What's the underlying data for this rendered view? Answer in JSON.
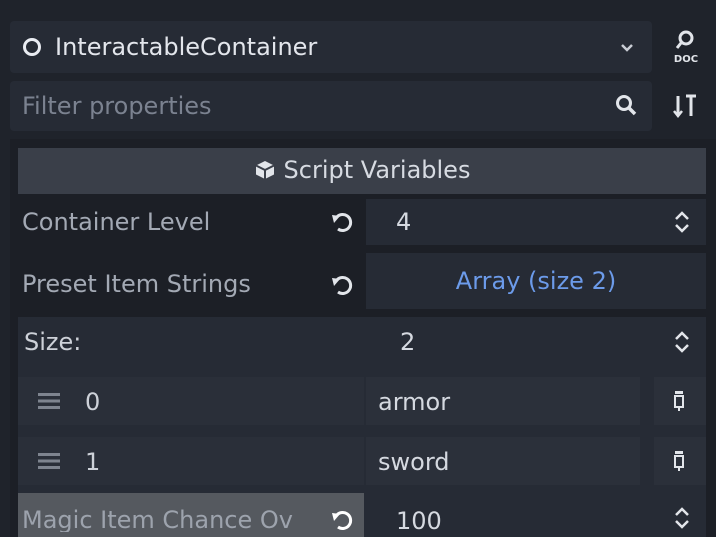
{
  "header": {
    "object_name": "InteractableContainer",
    "object_icon": "circle-node-icon",
    "dropdown_icon": "chevron-down-icon",
    "doc_button_icon": "doc-help-icon",
    "doc_label": "DOC"
  },
  "filter": {
    "placeholder": "Filter properties",
    "search_icon": "search-icon",
    "sort_icon": "sort-options-icon"
  },
  "section": {
    "title": "Script Variables",
    "icon": "script-cube-icon"
  },
  "properties": {
    "container_level": {
      "label": "Container Level",
      "value": "4"
    },
    "preset_item_strings": {
      "label": "Preset Item Strings",
      "button_label": "Array (size 2)",
      "size_label": "Size:",
      "size_value": "2",
      "items": [
        {
          "index": "0",
          "value": "armor"
        },
        {
          "index": "1",
          "value": "sword"
        }
      ]
    },
    "magic_item_chance": {
      "label": "Magic Item Chance Ov",
      "value": "100"
    }
  },
  "colors": {
    "background": "#1f232b",
    "field": "#262b35",
    "section_header": "#3a3f49",
    "link_blue": "#6c9bea",
    "highlight_label": "#55595f"
  }
}
